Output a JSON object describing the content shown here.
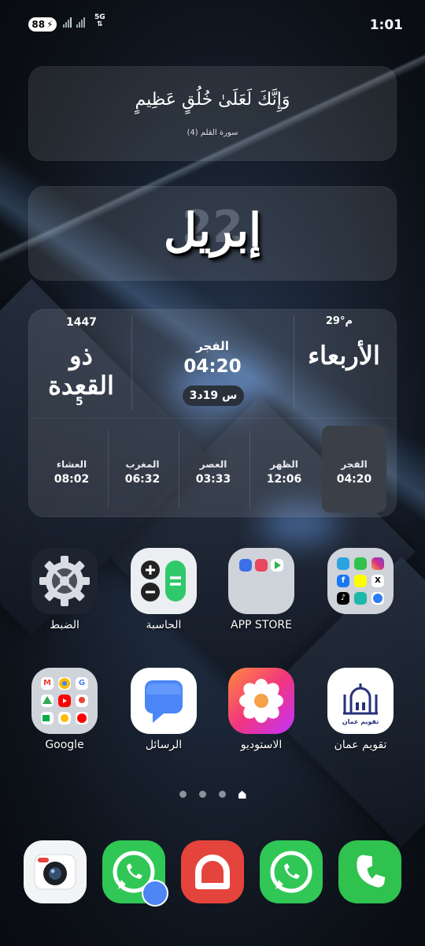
{
  "status_bar": {
    "battery": "88",
    "network": "5G",
    "time": "1:01"
  },
  "verse_widget": {
    "ayah": "وَإِنَّكَ لَعَلَىٰ خُلُقٍ عَظِيمٍ",
    "source": "سورة القلم (4)"
  },
  "date_widget": {
    "day": "22",
    "month": "إبريل"
  },
  "prayer_widget": {
    "hijri_year": "1447",
    "hijri_month": "ذو القعدة",
    "hijri_day": "5",
    "next_prayer_name": "الفجر",
    "next_prayer_time": "04:20",
    "countdown": "3س 19د",
    "weekday": "الأربعاء",
    "temperature": "29°م",
    "times": [
      {
        "name": "العشاء",
        "time": "08:02"
      },
      {
        "name": "المغرب",
        "time": "06:32"
      },
      {
        "name": "العصر",
        "time": "03:33"
      },
      {
        "name": "الظهر",
        "time": "12:06"
      },
      {
        "name": "الفجر",
        "time": "04:20",
        "active": true
      }
    ]
  },
  "apps": [
    {
      "label": "الضبط",
      "icon": "settings-gear-icon"
    },
    {
      "label": "الحاسبة",
      "icon": "calculator-icon"
    },
    {
      "label": "APP STORE",
      "icon": "folder-icon"
    },
    {
      "label": "",
      "icon": "social-folder-icon"
    },
    {
      "label": "Google",
      "icon": "google-folder-icon"
    },
    {
      "label": "الرسائل",
      "icon": "messages-icon"
    },
    {
      "label": "الاستوديو",
      "icon": "gallery-flower-icon"
    },
    {
      "label": "تقويم عمان",
      "icon": "mosque-calendar-icon",
      "icon_caption": "تقويم عمان"
    }
  ],
  "page_indicator": {
    "pages": 4,
    "current": 4
  },
  "dock": [
    {
      "icon": "camera-icon"
    },
    {
      "icon": "whatsapp-icon"
    },
    {
      "icon": "app-icon"
    },
    {
      "icon": "whatsapp-business-icon"
    },
    {
      "icon": "phone-icon"
    }
  ]
}
